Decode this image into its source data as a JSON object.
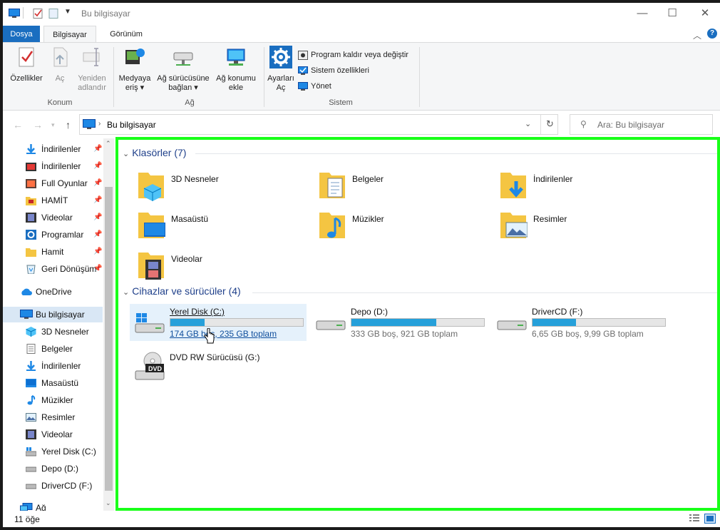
{
  "window": {
    "title": "Bu bilgisayar",
    "minimize": "—",
    "maximize": "☐",
    "close": "✕"
  },
  "ribbon_tabs": {
    "file": "Dosya",
    "computer": "Bilgisayar",
    "view": "Görünüm",
    "help": "?"
  },
  "ribbon": {
    "konum": {
      "label": "Konum",
      "properties": "Özellikler",
      "open": "Aç",
      "rename_1": "Yeniden",
      "rename_2": "adlandır"
    },
    "ag": {
      "label": "Ağ",
      "media_1": "Medyaya",
      "media_2": "eriş ▾",
      "map_1": "Ağ sürücüsüne",
      "map_2": "bağlan ▾",
      "add_1": "Ağ konumu",
      "add_2": "ekle"
    },
    "sistem": {
      "label": "Sistem",
      "settings_1": "Ayarları",
      "settings_2": "Aç",
      "uninstall": "Program kaldır veya değiştir",
      "sysprops": "Sistem özellikleri",
      "manage": "Yönet"
    }
  },
  "address": {
    "path": "Bu bilgisayar",
    "search_placeholder": "Ara: Bu bilgisayar"
  },
  "nav": {
    "quick": [
      {
        "label": "İndirilenler",
        "pin": "📌"
      },
      {
        "label": "İndirilenler",
        "pin": "📌"
      },
      {
        "label": "Full Oyunlar",
        "pin": "📌"
      },
      {
        "label": "HAMİT",
        "pin": "📌"
      },
      {
        "label": "Videolar",
        "pin": "📌"
      },
      {
        "label": "Programlar",
        "pin": "📌"
      },
      {
        "label": "Hamit",
        "pin": "📌"
      },
      {
        "label": "Geri Dönüşüm",
        "pin": "📌"
      }
    ],
    "onedrive": "OneDrive",
    "thispc": "Bu bilgisayar",
    "pc_items": [
      "3D Nesneler",
      "Belgeler",
      "İndirilenler",
      "Masaüstü",
      "Müzikler",
      "Resimler",
      "Videolar",
      "Yerel Disk (C:)",
      "Depo (D:)",
      "DriverCD (F:)"
    ],
    "network": "Ağ"
  },
  "content": {
    "folders_header": "Klasörler (7)",
    "folders": [
      "3D Nesneler",
      "Belgeler",
      "İndirilenler",
      "Masaüstü",
      "Müzikler",
      "Resimler",
      "Videolar"
    ],
    "devices_header": "Cihazlar ve sürücüler (4)",
    "drives": [
      {
        "name": "Yerel Disk (C:)",
        "free": "174 GB boş, 235 GB toplam",
        "used_fraction": 0.26
      },
      {
        "name": "Depo (D:)",
        "free": "333 GB boş, 921 GB toplam",
        "used_fraction": 0.64
      },
      {
        "name": "DriverCD (F:)",
        "free": "6,65 GB boş, 9,99 GB toplam",
        "used_fraction": 0.33
      }
    ],
    "dvd": {
      "name": "DVD RW Sürücüsü (G:)",
      "badge": "DVD"
    }
  },
  "status": {
    "count": "11 öğe"
  },
  "colors": {
    "accent": "#1a6ec0",
    "bar_fill": "#26a0da",
    "highlight_border": "#19ff19"
  }
}
